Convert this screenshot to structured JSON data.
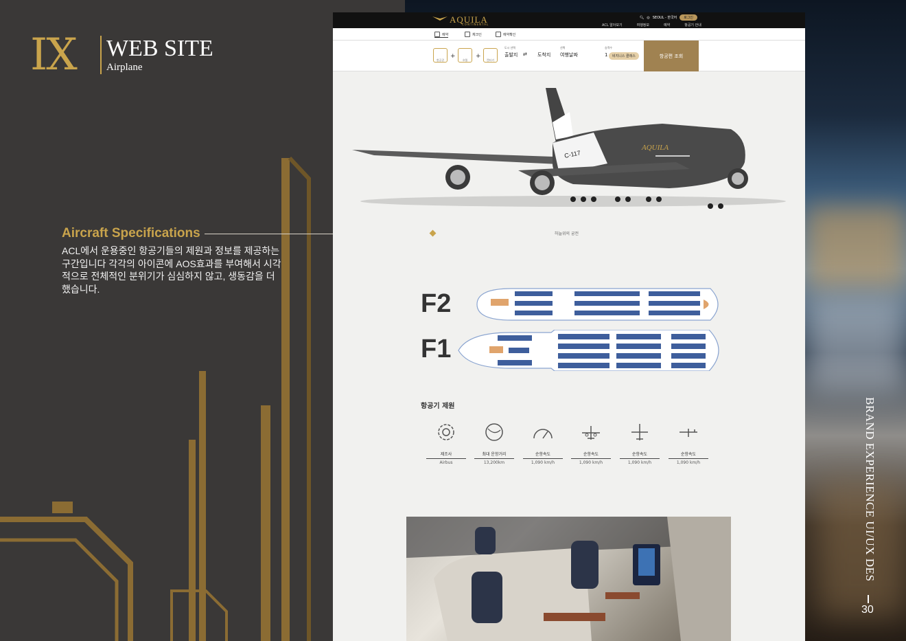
{
  "header": {
    "roman": "IX",
    "title": "WEB SITE",
    "subtitle": "Airplane"
  },
  "spec_section": {
    "title": "Aircraft Specifications",
    "description": "ACL에서 운용중인 항공기들의 제원과 정보를 제공하는 구간입니다 각각의 아이콘에 AOS효과를 부여해서 시각적으로 전체적인 분위기가 심심하지 않고, 생동감을 더했습니다."
  },
  "site": {
    "logo": "AQUILA",
    "logo_sub": "CONTINENTAL",
    "top_right": {
      "location": "SEOUL - 한국어",
      "login": "로그인"
    },
    "nav": [
      "ACL 알아보기",
      "여행정보",
      "예약",
      "항공기 안내"
    ],
    "tabs": [
      "예약",
      "체크인",
      "예약확인"
    ],
    "search": {
      "icon_labels": [
        "항공권",
        "호텔",
        "렌터카"
      ],
      "origin_label": "도시 선택",
      "origin": "출발지",
      "destination": "도착지",
      "date_label": "선택",
      "date": "여행날짜",
      "pax_label": "승객수",
      "pax": "1",
      "class": "비지니스 클래스",
      "button": "항공편 조회"
    },
    "caption": "하늘위의 궁전",
    "floors": [
      "F2",
      "F1"
    ],
    "specs_title": "항공기 제원",
    "specs": [
      {
        "name": "제조사",
        "value": "Airbus",
        "icon": "gear-wrench-icon"
      },
      {
        "name": "최대 운항거리",
        "value": "13,200km",
        "icon": "globe-icon"
      },
      {
        "name": "순항속도",
        "value": "1,090 km/h",
        "icon": "speedometer-icon"
      },
      {
        "name": "순항속도",
        "value": "1,090 km/h",
        "icon": "plane-front-icon"
      },
      {
        "name": "순항속도",
        "value": "1,090 km/h",
        "icon": "plane-top-icon"
      },
      {
        "name": "순항속도",
        "value": "1,090 km/h",
        "icon": "plane-side-icon"
      }
    ]
  },
  "side": {
    "vertical_text": "BRAND EXPERIENCE UI/UX DES",
    "page_number": "30"
  },
  "colors": {
    "gold": "#c9a44c",
    "dark": "#3a3837",
    "seat_blue": "#3e5e9c",
    "accent": "#e0a46c"
  }
}
